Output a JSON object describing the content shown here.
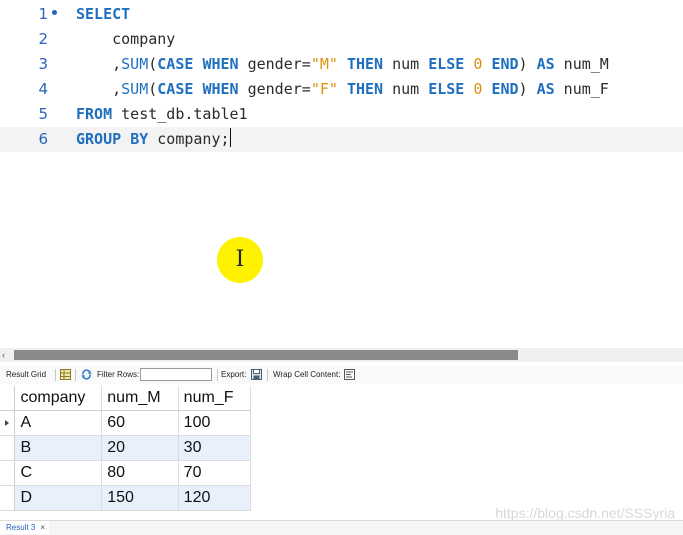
{
  "editor": {
    "lines": [
      {
        "number": "1",
        "tokens": [
          {
            "t": "SELECT",
            "c": "kw"
          }
        ]
      },
      {
        "number": "2",
        "tokens": [
          {
            "t": "    company",
            "c": ""
          }
        ]
      },
      {
        "number": "3",
        "tokens": [
          {
            "t": "    ,",
            "c": ""
          },
          {
            "t": "SUM",
            "c": "fn"
          },
          {
            "t": "(",
            "c": ""
          },
          {
            "t": "CASE",
            "c": "kw"
          },
          {
            "t": " ",
            "c": ""
          },
          {
            "t": "WHEN",
            "c": "kw"
          },
          {
            "t": " gender=",
            "c": ""
          },
          {
            "t": "\"M\"",
            "c": "str"
          },
          {
            "t": " ",
            "c": ""
          },
          {
            "t": "THEN",
            "c": "kw"
          },
          {
            "t": " num ",
            "c": ""
          },
          {
            "t": "ELSE",
            "c": "kw"
          },
          {
            "t": " ",
            "c": ""
          },
          {
            "t": "0",
            "c": "num"
          },
          {
            "t": " ",
            "c": ""
          },
          {
            "t": "END",
            "c": "kw"
          },
          {
            "t": ") ",
            "c": ""
          },
          {
            "t": "AS",
            "c": "kw"
          },
          {
            "t": " num_M",
            "c": ""
          }
        ]
      },
      {
        "number": "4",
        "tokens": [
          {
            "t": "    ,",
            "c": ""
          },
          {
            "t": "SUM",
            "c": "fn"
          },
          {
            "t": "(",
            "c": ""
          },
          {
            "t": "CASE",
            "c": "kw"
          },
          {
            "t": " ",
            "c": ""
          },
          {
            "t": "WHEN",
            "c": "kw"
          },
          {
            "t": " gender=",
            "c": ""
          },
          {
            "t": "\"F\"",
            "c": "str"
          },
          {
            "t": " ",
            "c": ""
          },
          {
            "t": "THEN",
            "c": "kw"
          },
          {
            "t": " num ",
            "c": ""
          },
          {
            "t": "ELSE",
            "c": "kw"
          },
          {
            "t": " ",
            "c": ""
          },
          {
            "t": "0",
            "c": "num"
          },
          {
            "t": " ",
            "c": ""
          },
          {
            "t": "END",
            "c": "kw"
          },
          {
            "t": ") ",
            "c": ""
          },
          {
            "t": "AS",
            "c": "kw"
          },
          {
            "t": " num_F",
            "c": ""
          }
        ]
      },
      {
        "number": "5",
        "tokens": [
          {
            "t": "FROM",
            "c": "kw"
          },
          {
            "t": " test_db.table1",
            "c": ""
          }
        ]
      },
      {
        "number": "6",
        "tokens": [
          {
            "t": "GROUP",
            "c": "kw"
          },
          {
            "t": " ",
            "c": ""
          },
          {
            "t": "BY",
            "c": "kw"
          },
          {
            "t": " company;",
            "c": ""
          }
        ]
      }
    ],
    "current_line": 6,
    "folded_line": 1
  },
  "cursor_icon": "i-beam-cursor-icon",
  "cursor_highlight_color": "#fff200",
  "scrollbar": {
    "left_arrow": "‹",
    "thumb_fraction": 0.755
  },
  "toolbar": {
    "result_grid_label": "Result Grid",
    "grid_icon": "grid-icon",
    "refresh_icon": "refresh-icon",
    "filter_rows_label": "Filter Rows:",
    "filter_value": "",
    "export_label": "Export:",
    "export_icon": "export-icon",
    "wrap_cell_label": "Wrap Cell Content:",
    "wrap_icon": "wrap-icon"
  },
  "grid": {
    "columns": [
      "company",
      "num_M",
      "num_F"
    ],
    "rows": [
      [
        "A",
        "60",
        "100"
      ],
      [
        "B",
        "20",
        "30"
      ],
      [
        "C",
        "80",
        "70"
      ],
      [
        "D",
        "150",
        "120"
      ]
    ],
    "selected_row": 0
  },
  "bottom": {
    "result_tab": "Result 3",
    "close": "×",
    "watermark": "https://blog.csdn.net/SSSyria"
  },
  "colors": {
    "keyword": "#1f6fbf",
    "string": "#d8920b",
    "line_number": "#2a63b8",
    "alt_row": "#e8f0fb"
  }
}
